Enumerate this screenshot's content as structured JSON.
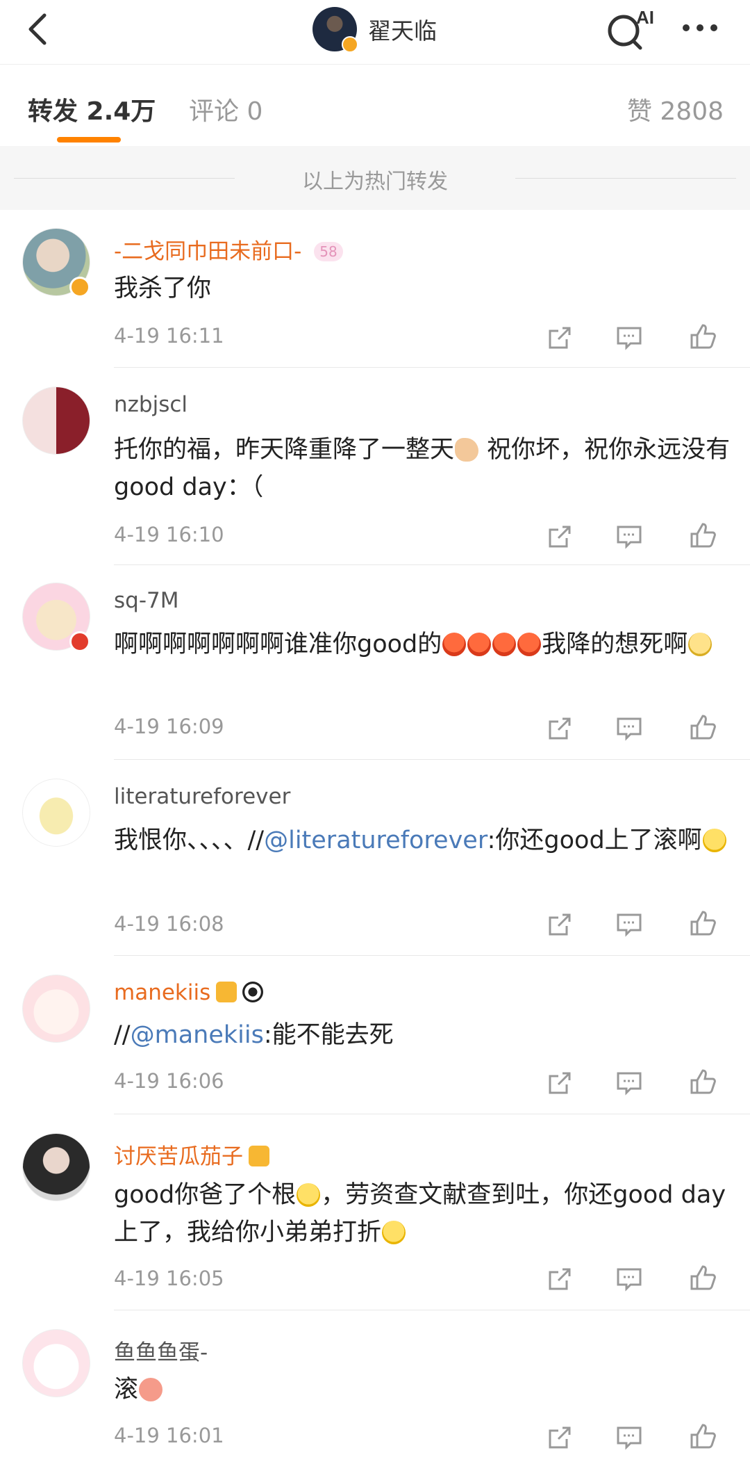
{
  "header": {
    "title": "翟天临",
    "ai_label": "AI"
  },
  "tabs": {
    "repost": "转发 2.4万",
    "comment": "评论 0",
    "like": "赞 2808"
  },
  "section_label": "以上为热门转发",
  "comments": [
    {
      "user": "-二戈同巾田未前口-",
      "badge_text": "58",
      "text": "我杀了你",
      "time": "4-19 16:11"
    },
    {
      "user": "nzbjscl",
      "text_a": "托你的福，昨天降重降了一整天",
      "text_b": " 祝你坏，祝你永远没有good day：（",
      "time": "4-19 16:10"
    },
    {
      "user": "sq-7M",
      "text_a": "啊啊啊啊啊啊啊谁准你good的",
      "text_b": "我降的想死啊",
      "time": "4-19 16:09"
    },
    {
      "user": "literatureforever",
      "text_a": "我恨你、、、、//",
      "mention": "@literatureforever",
      "text_b": ":你还good上了滚啊",
      "time": "4-19 16:08"
    },
    {
      "user": "manekiis",
      "text_a": "//",
      "mention": "@manekiis",
      "text_b": ":能不能去死",
      "time": "4-19 16:06"
    },
    {
      "user": "讨厌苦瓜茄子",
      "text_a": "good你爸了个根",
      "text_b": "，劳资查文献查到吐，你还good day上了，我给你小弟弟打折",
      "time": "4-19 16:05"
    },
    {
      "user": "鱼鱼鱼蛋-",
      "text_a": "滚",
      "time": "4-19 16:01"
    }
  ]
}
